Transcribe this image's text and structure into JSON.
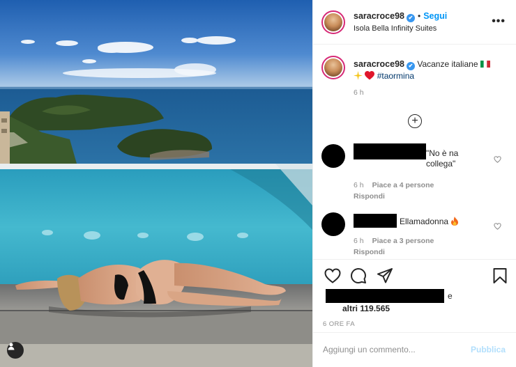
{
  "post": {
    "username": "saracroce98",
    "verified_glyph": "✔",
    "follow_label": "Segui",
    "separator": "•",
    "location": "Isola Bella Infinity Suites",
    "more_icon": "•••",
    "caption_text": "Vacanze italiane",
    "caption_hashtag": "#taormina",
    "caption_emojis": [
      "it-flag",
      "sparkles",
      "red-heart"
    ],
    "caption_time": "6 h",
    "load_more_glyph": "+"
  },
  "comments": [
    {
      "text": "\"No è na collega\"",
      "time": "6 h",
      "likes": "Piace a 4 persone",
      "reply": "Rispondi"
    },
    {
      "text": "Ellamadonna",
      "emoji": "fire",
      "time": "6 h",
      "likes": "Piace a 3 persone",
      "reply": "Rispondi"
    }
  ],
  "actions": {
    "icons": [
      "heart-icon",
      "comment-icon",
      "share-icon",
      "bookmark-icon"
    ],
    "likes_connector": "e",
    "likes_others": "altri 119.565",
    "post_time": "6 ORE FA"
  },
  "comment_box": {
    "placeholder": "Aggiungi un commento...",
    "publish_label": "Pubblica"
  },
  "colors": {
    "accent": "#0095f6",
    "verified": "#3897f0",
    "hashtag": "#00376b",
    "muted": "#8e8e8e",
    "publish_disabled": "#b2dffc",
    "story_ring": "#d62976"
  }
}
